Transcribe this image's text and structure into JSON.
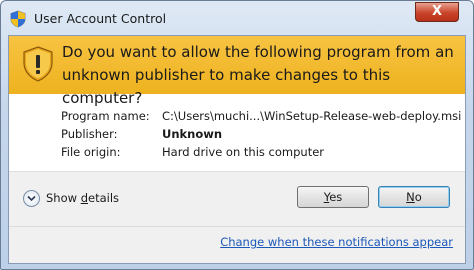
{
  "window": {
    "title": "User Account Control",
    "close_label": "X",
    "icon": "uac-shield-icon"
  },
  "banner": {
    "question": "Do you want to allow the following program from an unknown publisher to make changes to this computer?",
    "icon": "warning-shield-icon",
    "color": "#f2b92a"
  },
  "details": {
    "program_name_label": "Program name:",
    "program_name_value": "C:\\Users\\muchi...\\WinSetup-Release-web-deploy.msi",
    "publisher_label": "Publisher:",
    "publisher_value": "Unknown",
    "file_origin_label": "File origin:",
    "file_origin_value": "Hard drive on this computer"
  },
  "footer": {
    "show_details_prefix": "Show ",
    "show_details_accel": "d",
    "show_details_suffix": "etails",
    "yes_accel": "Y",
    "yes_rest": "es",
    "no_accel": "N",
    "no_rest": "o",
    "notifications_link": "Change when these notifications appear",
    "link_color": "#1c58b8"
  }
}
